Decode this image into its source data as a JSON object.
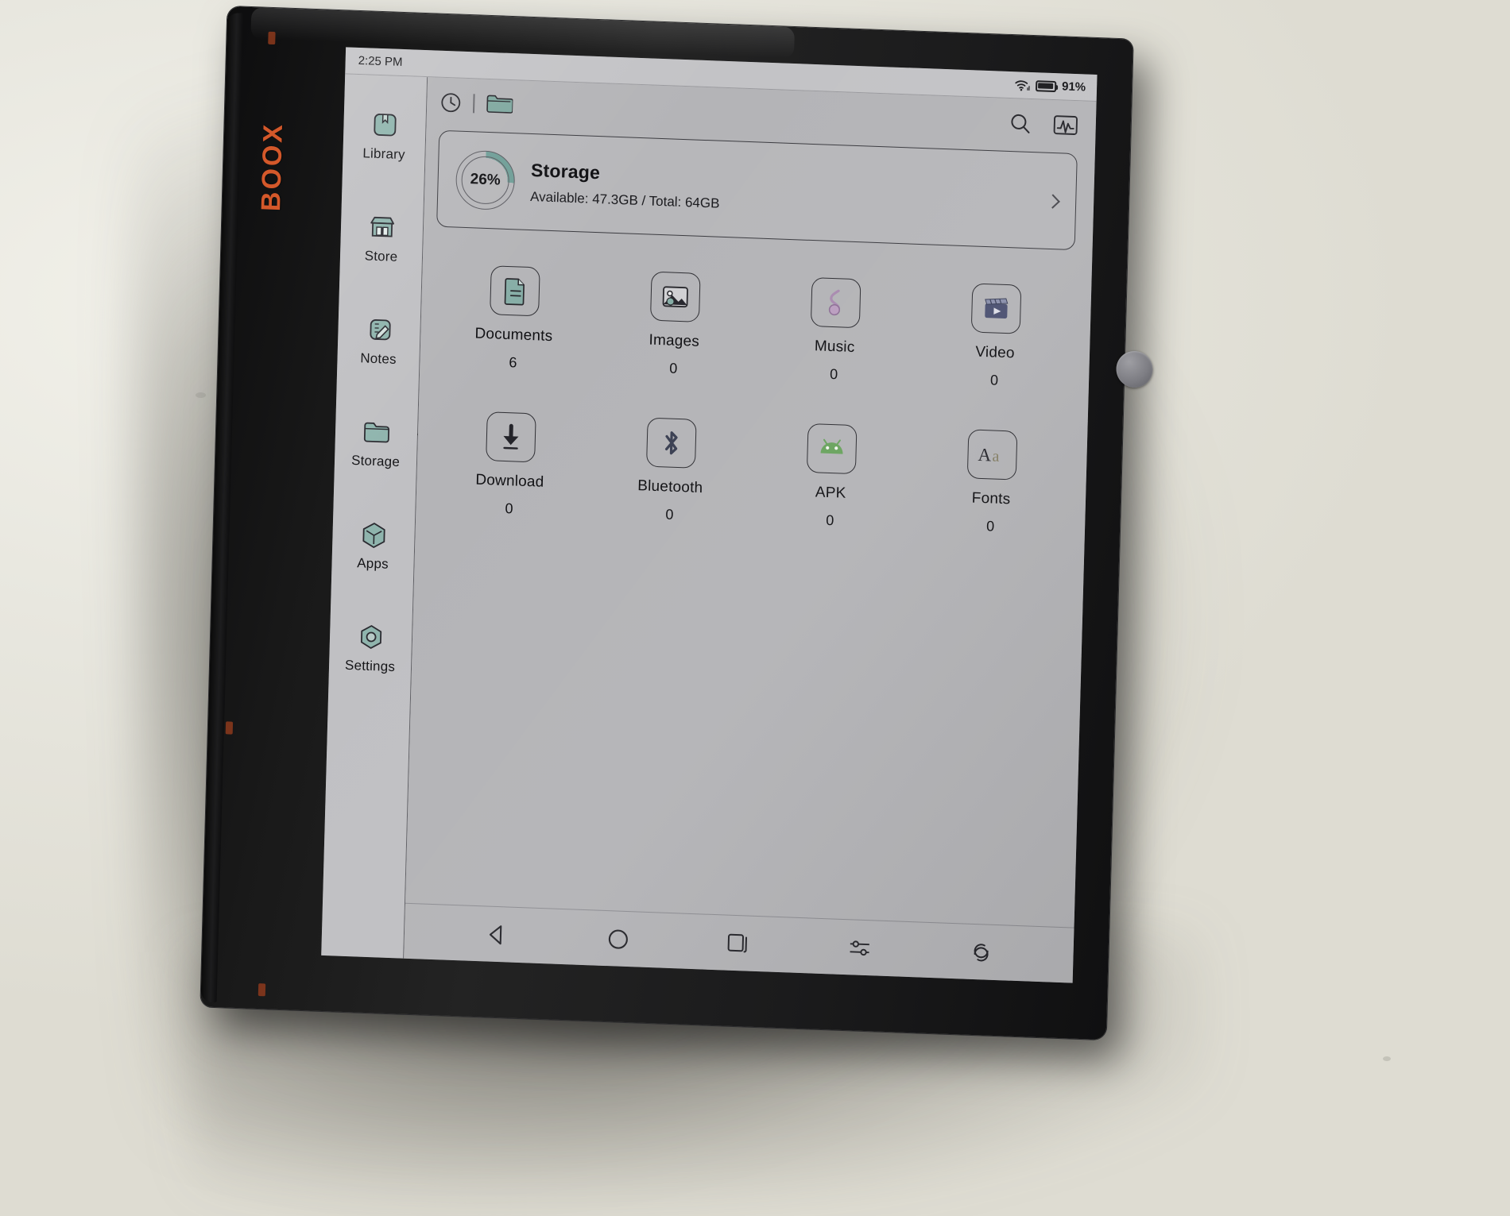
{
  "device": {
    "brand_logo": "BOOX"
  },
  "status_bar": {
    "time": "2:25 PM",
    "wifi_icon": "wifi-icon",
    "battery_icon": "battery-icon",
    "battery_percent": "91%"
  },
  "toolbar": {
    "recent_icon": "clock-icon",
    "folder_icon": "folder-icon",
    "search_icon": "search-icon",
    "analytics_icon": "activity-chart-icon"
  },
  "sidebar": {
    "items": [
      {
        "label": "Library",
        "icon": "library-book-icon",
        "active": false
      },
      {
        "label": "Store",
        "icon": "store-icon",
        "active": false
      },
      {
        "label": "Notes",
        "icon": "notes-pencil-icon",
        "active": false
      },
      {
        "label": "Storage",
        "icon": "folder-icon",
        "active": true
      },
      {
        "label": "Apps",
        "icon": "apps-cube-icon",
        "active": false
      },
      {
        "label": "Settings",
        "icon": "settings-gear-icon",
        "active": false
      }
    ]
  },
  "storage_card": {
    "percent_label": "26%",
    "percent_value": 26,
    "title": "Storage",
    "details": "Available: 47.3GB / Total: 64GB",
    "chevron_icon": "chevron-right-icon",
    "ring_color": "#6f9e97"
  },
  "categories": [
    {
      "label": "Documents",
      "count": "6",
      "icon": "document-icon",
      "color": "#7fa8a2"
    },
    {
      "label": "Images",
      "count": "0",
      "icon": "image-icon",
      "color": "#2b2b33"
    },
    {
      "label": "Music",
      "count": "0",
      "icon": "music-note-icon",
      "color": "#b08fb5"
    },
    {
      "label": "Video",
      "count": "0",
      "icon": "video-clapper-icon",
      "color": "#4c5272"
    },
    {
      "label": "Download",
      "count": "0",
      "icon": "download-arrow-icon",
      "color": "#232329"
    },
    {
      "label": "Bluetooth",
      "count": "0",
      "icon": "bluetooth-icon",
      "color": "#3a3f52"
    },
    {
      "label": "APK",
      "count": "0",
      "icon": "android-robot-icon",
      "color": "#6aa45f"
    },
    {
      "label": "Fonts",
      "count": "0",
      "icon": "font-aa-icon",
      "color": "#2a2a30"
    }
  ],
  "navbar": {
    "buttons": [
      {
        "icon": "back-triangle-icon",
        "name": "nav-back"
      },
      {
        "icon": "home-circle-icon",
        "name": "nav-home"
      },
      {
        "icon": "recents-square-icon",
        "name": "nav-recents"
      },
      {
        "icon": "settings-sliders-icon",
        "name": "nav-quick-settings"
      },
      {
        "icon": "refresh-swirl-icon",
        "name": "nav-refresh"
      }
    ]
  }
}
